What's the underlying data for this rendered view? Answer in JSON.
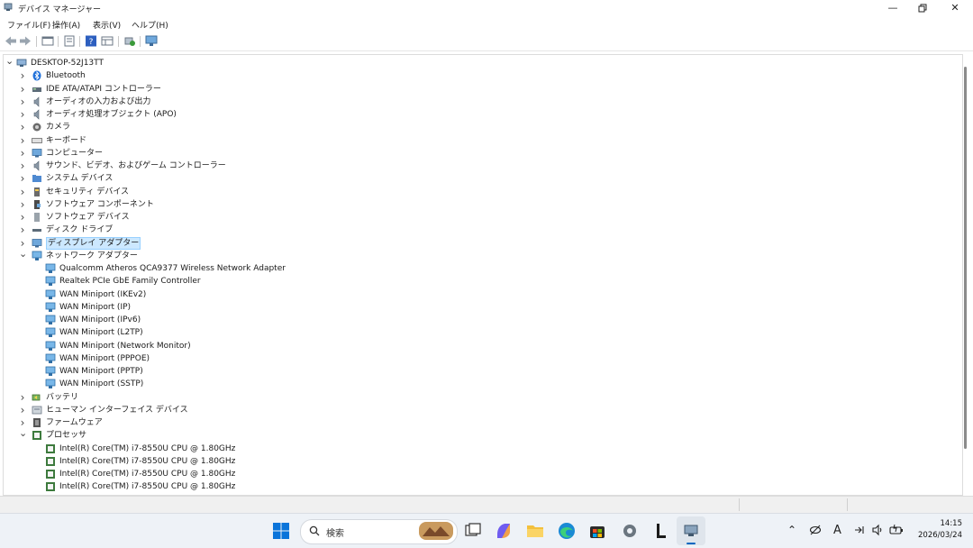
{
  "window": {
    "title": "デバイス マネージャー"
  },
  "menu": [
    "ファイル(F)",
    "操作(A)",
    "表示(V)",
    "ヘルプ(H)"
  ],
  "tree": {
    "root": "DESKTOP-52J13TT",
    "categories": [
      "Bluetooth",
      "IDE ATA/ATAPI コントローラー",
      "オーディオの入力および出力",
      "オーディオ処理オブジェクト (APO)",
      "カメラ",
      "キーボード",
      "コンピューター",
      "サウンド、ビデオ、およびゲーム コントローラー",
      "システム デバイス",
      "セキュリティ デバイス",
      "ソフトウェア コンポーネント",
      "ソフトウェア デバイス",
      "ディスク ドライブ",
      "ディスプレイ アダプター",
      "ネットワーク アダプター"
    ],
    "network_adapters": [
      "Qualcomm Atheros QCA9377 Wireless Network Adapter",
      "Realtek PCIe GbE Family Controller",
      "WAN Miniport (IKEv2)",
      "WAN Miniport (IP)",
      "WAN Miniport (IPv6)",
      "WAN Miniport (L2TP)",
      "WAN Miniport (Network Monitor)",
      "WAN Miniport (PPPOE)",
      "WAN Miniport (PPTP)",
      "WAN Miniport (SSTP)"
    ],
    "categories_after": [
      "バッテリ",
      "ヒューマン インターフェイス デバイス",
      "ファームウェア",
      "プロセッサ"
    ],
    "processors": [
      "Intel(R) Core(TM) i7-8550U CPU @ 1.80GHz",
      "Intel(R) Core(TM) i7-8550U CPU @ 1.80GHz",
      "Intel(R) Core(TM) i7-8550U CPU @ 1.80GHz",
      "Intel(R) Core(TM) i7-8550U CPU @ 1.80GHz"
    ],
    "selected": "ディスプレイ アダプター"
  },
  "taskbar": {
    "search_placeholder": "検索",
    "time": "14:15",
    "date": "2026/03/24",
    "ime": "A"
  },
  "colors": {
    "accent": "#0067c0",
    "selection": "#cce8ff",
    "taskbar": "#eef2f7"
  }
}
